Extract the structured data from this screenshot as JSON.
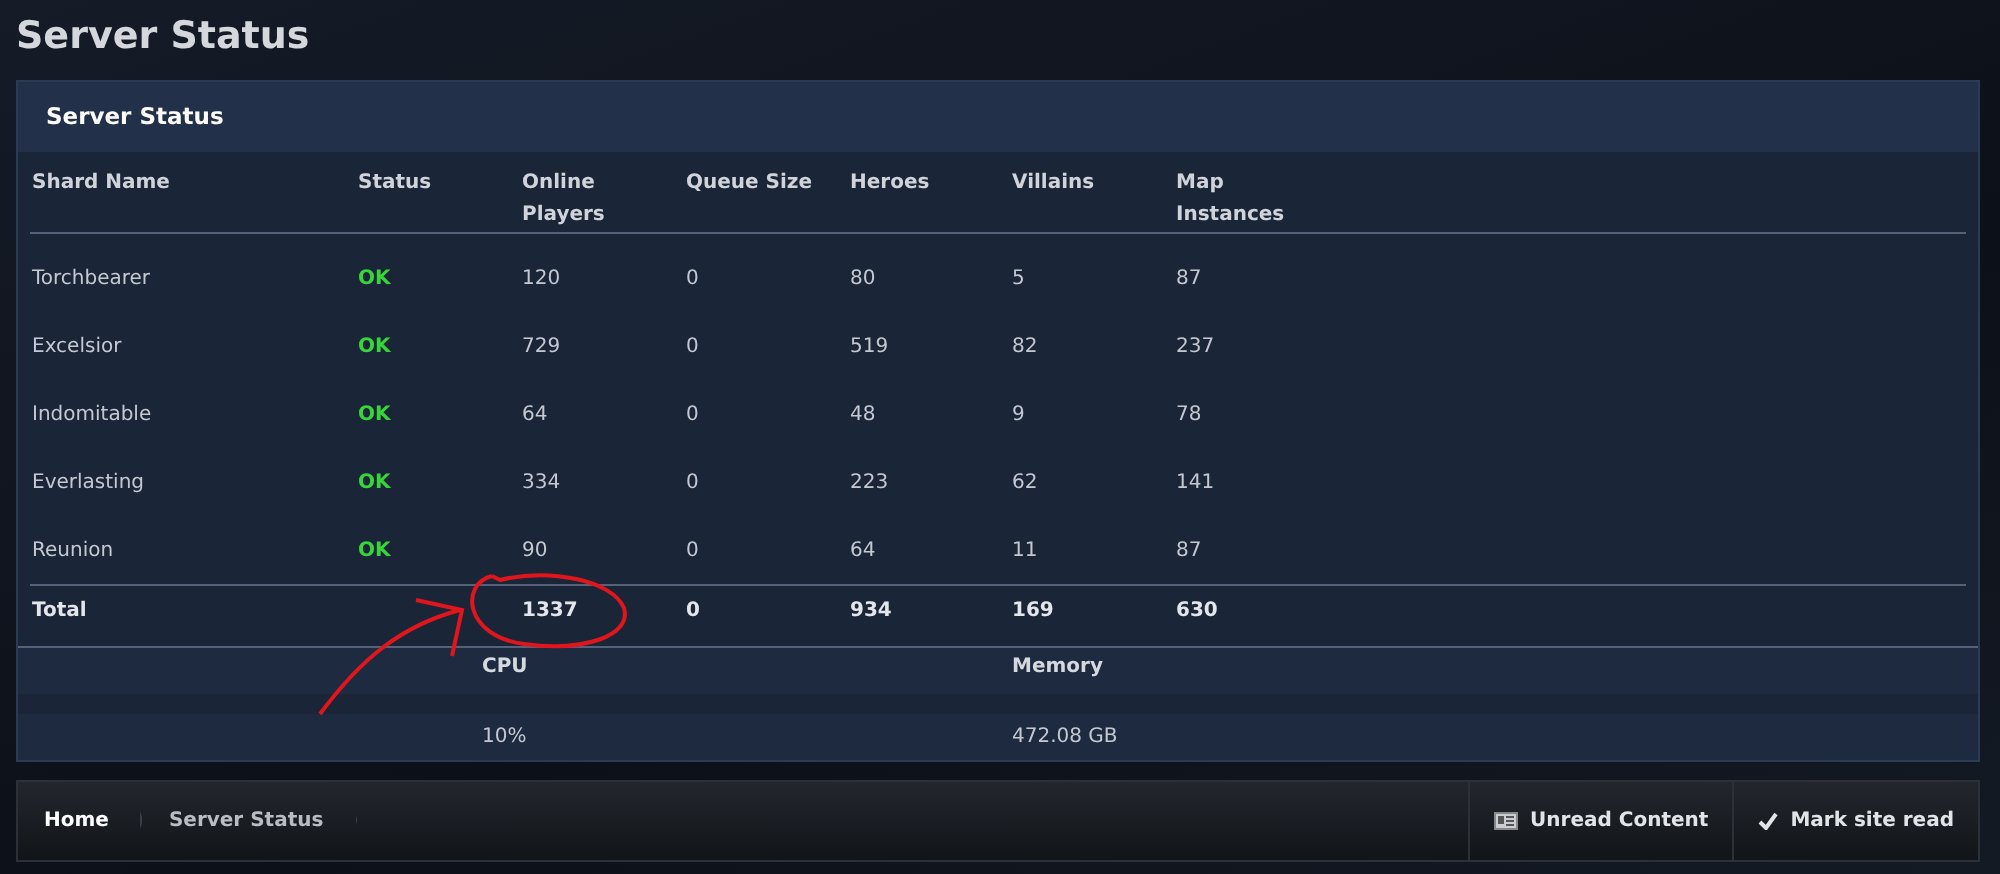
{
  "page_title": "Server Status",
  "panel": {
    "title": "Server Status",
    "columns": [
      "Shard Name",
      "Status",
      "Online Players",
      "Queue Size",
      "Heroes",
      "Villains",
      "Map Instances"
    ],
    "rows": [
      {
        "shard": "Torchbearer",
        "status": "OK",
        "up": true,
        "online": "120",
        "queue": "0",
        "heroes": "80",
        "villains": "5",
        "maps": "87"
      },
      {
        "shard": "Excelsior",
        "status": "OK",
        "up": true,
        "online": "729",
        "queue": "0",
        "heroes": "519",
        "villains": "82",
        "maps": "237"
      },
      {
        "shard": "Indomitable",
        "status": "OK",
        "up": true,
        "online": "64",
        "queue": "0",
        "heroes": "48",
        "villains": "9",
        "maps": "78"
      },
      {
        "shard": "Everlasting",
        "status": "OK",
        "up": true,
        "online": "334",
        "queue": "0",
        "heroes": "223",
        "villains": "62",
        "maps": "141"
      },
      {
        "shard": "Reunion",
        "status": "OK",
        "up": true,
        "online": "90",
        "queue": "0",
        "heroes": "64",
        "villains": "11",
        "maps": "87"
      }
    ],
    "total": {
      "label": "Total",
      "online": "1337",
      "queue": "0",
      "heroes": "934",
      "villains": "169",
      "maps": "630"
    },
    "stats": [
      {
        "label": "CPU",
        "value": "10%"
      },
      {
        "label": "Memory",
        "value": "472.08 GB"
      }
    ]
  },
  "annotation": {
    "kind": "circle-arrow"
  },
  "breadcrumbs": [
    "Home",
    "Server Status"
  ],
  "footer_links": [
    {
      "label": "Unread Content",
      "kind": "unread"
    },
    {
      "label": "Mark site read",
      "kind": "check"
    }
  ]
}
